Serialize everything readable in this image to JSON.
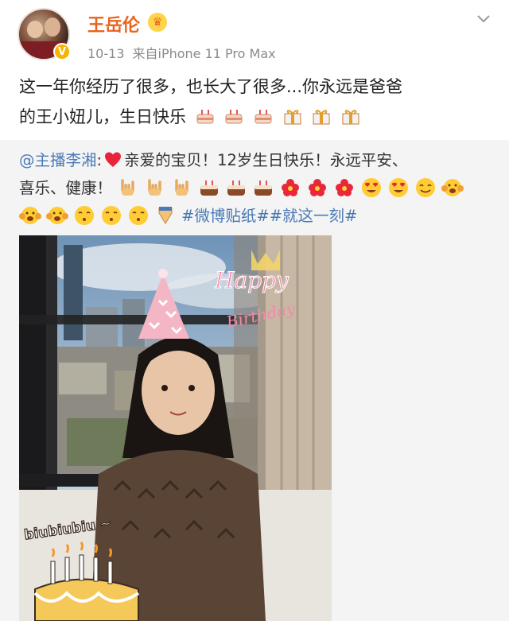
{
  "post": {
    "author": "王岳伦",
    "date": "10-13",
    "source": "来自iPhone 11 Pro Max",
    "text_line1": "这一年你经历了很多，也长大了很多...你永远是爸爸",
    "text_line2": "的王小妞儿，生日快乐"
  },
  "repost": {
    "mention": "@主播李湘",
    "colon": ":",
    "line1_text": "亲爱的宝贝！12岁生日快乐！永远平安、",
    "line2_text": "喜乐、健康！",
    "topic1": "#微博贴纸#",
    "topic2": "#就这一刻#"
  },
  "photo": {
    "sticker_happy": "Happy",
    "sticker_birthday": "Birthday",
    "sticker_biu": "biubiubiu ~"
  },
  "icons": {
    "badge": "verified-v-icon",
    "crown": "crown-icon",
    "menu": "chevron-down-icon"
  },
  "colors": {
    "username": "#e8641c",
    "link": "#4a7ab5",
    "repost_bg": "#f4f4f4"
  }
}
